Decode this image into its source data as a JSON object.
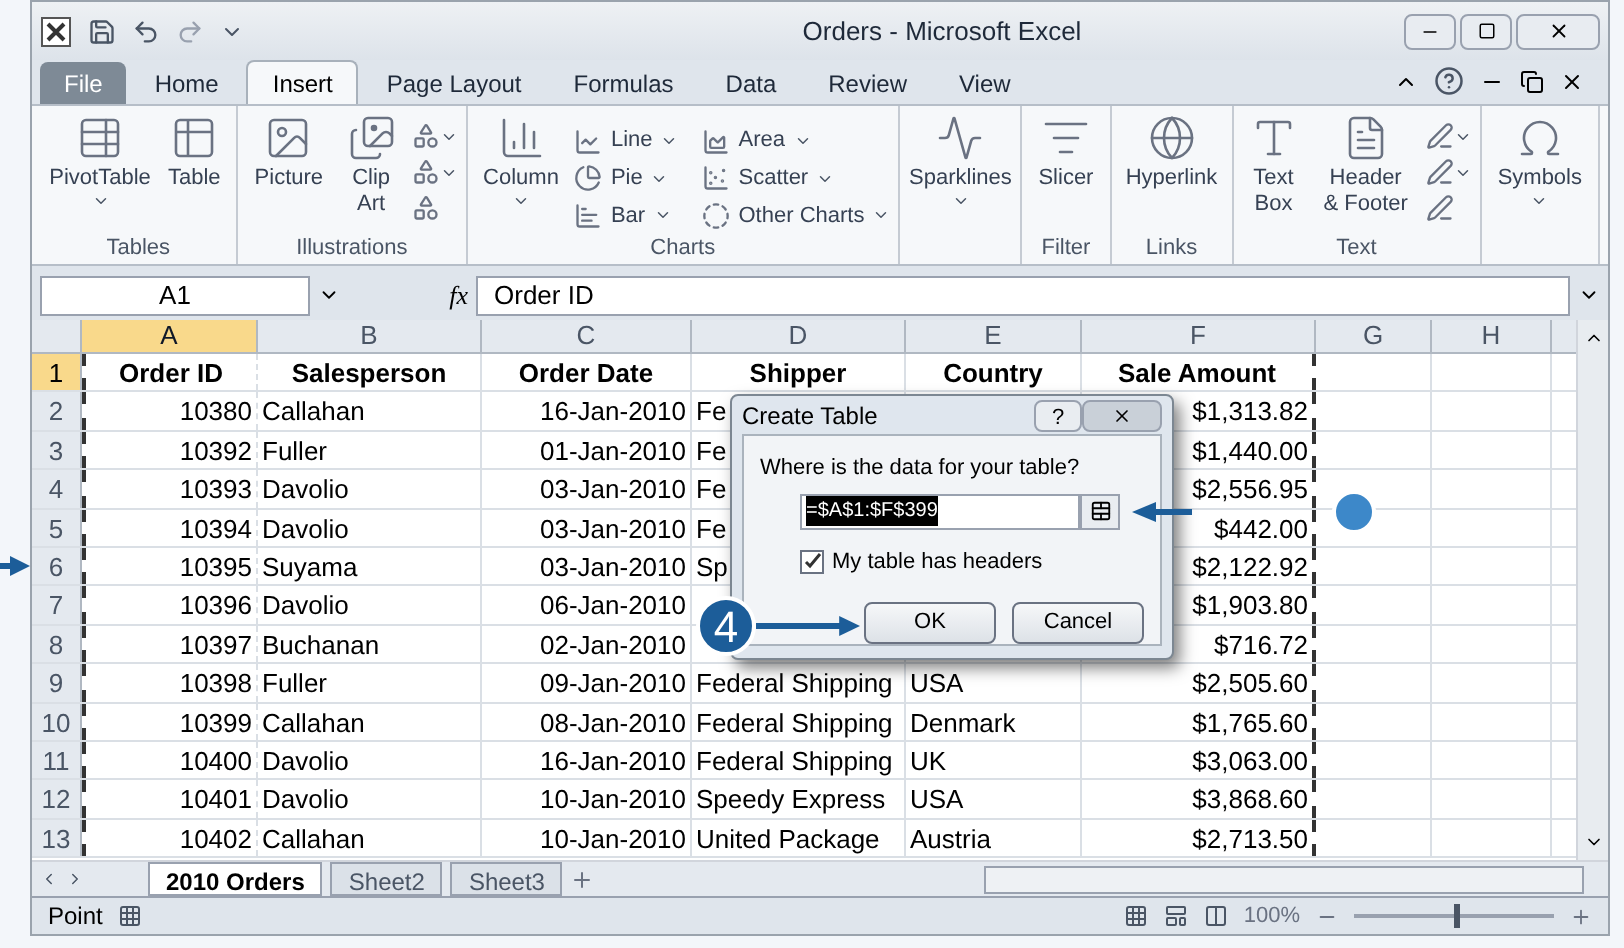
{
  "window": {
    "title": "Orders - Microsoft Excel"
  },
  "ribbon_tabs": [
    {
      "label": "File",
      "kind": "file",
      "selected": false
    },
    {
      "label": "Home",
      "kind": "tab",
      "selected": false
    },
    {
      "label": "Insert",
      "kind": "tab",
      "selected": true
    },
    {
      "label": "Page Layout",
      "kind": "tab",
      "selected": false
    },
    {
      "label": "Formulas",
      "kind": "tab",
      "selected": false
    },
    {
      "label": "Data",
      "kind": "tab",
      "selected": false
    },
    {
      "label": "Review",
      "kind": "tab",
      "selected": false
    },
    {
      "label": "View",
      "kind": "tab",
      "selected": false
    }
  ],
  "ribbon_groups": [
    {
      "label": "Tables",
      "buttons": [
        {
          "label": "PivotTable",
          "kind": "large",
          "dropdown": true
        },
        {
          "label": "Table",
          "kind": "large",
          "dropdown": false
        }
      ]
    },
    {
      "label": "Illustrations",
      "buttons": [
        {
          "label": "Picture",
          "kind": "large",
          "dropdown": false
        },
        {
          "label": "Clip Art",
          "kind": "large",
          "dropdown": false
        },
        {
          "kind": "stack",
          "dropdown": true
        }
      ]
    },
    {
      "label": "Charts",
      "buttons": [
        {
          "label": "Column",
          "kind": "large",
          "dropdown": true
        },
        {
          "label": "Line",
          "kind": "small",
          "dropdown": true
        },
        {
          "label": "Pie",
          "kind": "small",
          "dropdown": true
        },
        {
          "label": "Bar",
          "kind": "small",
          "dropdown": true
        },
        {
          "label": "Area",
          "kind": "small",
          "dropdown": true
        },
        {
          "label": "Scatter",
          "kind": "small",
          "dropdown": true
        },
        {
          "label": "Other Charts",
          "kind": "small",
          "dropdown": true
        }
      ]
    },
    {
      "buttons": [
        {
          "label": "Sparklines",
          "kind": "large",
          "dropdown": true
        }
      ]
    },
    {
      "label": "Filter",
      "buttons": [
        {
          "label": "Slicer",
          "kind": "large",
          "dropdown": false
        }
      ]
    },
    {
      "label": "Links",
      "buttons": [
        {
          "label": "Hyperlink",
          "kind": "large",
          "dropdown": false
        }
      ]
    },
    {
      "label": "Text",
      "buttons": [
        {
          "label": "Text Box",
          "kind": "large",
          "dropdown": false
        },
        {
          "label": "Header & Footer",
          "kind": "large",
          "dropdown": false
        },
        {
          "kind": "stack",
          "dropdown": true
        }
      ]
    },
    {
      "buttons": [
        {
          "label": "Symbols",
          "kind": "large",
          "dropdown": true
        }
      ]
    }
  ],
  "formula_bar": {
    "name_box": "A1",
    "function_label": "fx",
    "value": "Order ID"
  },
  "columns": [
    {
      "label": "A",
      "selected": true
    },
    {
      "label": "B",
      "selected": false
    },
    {
      "label": "C",
      "selected": false
    },
    {
      "label": "D",
      "selected": false
    },
    {
      "label": "E",
      "selected": false
    },
    {
      "label": "F",
      "selected": false
    },
    {
      "label": "G",
      "selected": false
    },
    {
      "label": "H",
      "selected": false
    }
  ],
  "table": {
    "header": [
      "Order ID",
      "Salesperson",
      "Order Date",
      "Shipper",
      "Country",
      "Sale Amount"
    ],
    "rows": [
      {
        "number": "1",
        "selected": true
      },
      {
        "number": "2",
        "selected": false,
        "cells": [
          "10380",
          "Callahan",
          "16-Jan-2010",
          "Fe",
          "",
          "$1,313.82"
        ]
      },
      {
        "number": "3",
        "selected": false,
        "cells": [
          "10392",
          "Fuller",
          "01-Jan-2010",
          "Fe",
          "",
          "$1,440.00"
        ]
      },
      {
        "number": "4",
        "selected": false,
        "cells": [
          "10393",
          "Davolio",
          "03-Jan-2010",
          "Fe",
          "",
          "$2,556.95"
        ]
      },
      {
        "number": "5",
        "selected": false,
        "cells": [
          "10394",
          "Davolio",
          "03-Jan-2010",
          "Fe",
          "",
          "$442.00"
        ]
      },
      {
        "number": "6",
        "selected": false,
        "cells": [
          "10395",
          "Suyama",
          "03-Jan-2010",
          "Sp",
          "",
          "$2,122.92"
        ]
      },
      {
        "number": "7",
        "selected": false,
        "cells": [
          "10396",
          "Davolio",
          "06-Jan-2010",
          "",
          "",
          "$1,903.80"
        ]
      },
      {
        "number": "8",
        "selected": false,
        "cells": [
          "10397",
          "Buchanan",
          "02-Jan-2010",
          "",
          "",
          "$716.72"
        ]
      },
      {
        "number": "9",
        "selected": false,
        "cells": [
          "10398",
          "Fuller",
          "09-Jan-2010",
          "Federal Shipping",
          "USA",
          "$2,505.60"
        ]
      },
      {
        "number": "10",
        "selected": false,
        "cells": [
          "10399",
          "Callahan",
          "08-Jan-2010",
          "Federal Shipping",
          "Denmark",
          "$1,765.60"
        ]
      },
      {
        "number": "11",
        "selected": false,
        "cells": [
          "10400",
          "Davolio",
          "16-Jan-2010",
          "Federal Shipping",
          "UK",
          "$3,063.00"
        ]
      },
      {
        "number": "12",
        "selected": false,
        "cells": [
          "10401",
          "Davolio",
          "10-Jan-2010",
          "Speedy Express",
          "USA",
          "$3,868.60"
        ]
      },
      {
        "number": "13",
        "selected": false,
        "cells": [
          "10402",
          "Callahan",
          "10-Jan-2010",
          "United Package",
          "Austria",
          "$2,713.50"
        ]
      }
    ]
  },
  "sheet_tabs": [
    {
      "label": "2010 Orders",
      "selected": true
    },
    {
      "label": "Sheet2",
      "selected": false
    },
    {
      "label": "Sheet3",
      "selected": false
    }
  ],
  "status_bar": {
    "mode": "Point",
    "zoom": "100%",
    "level": 0.5
  },
  "dialog": {
    "title": "Create Table",
    "help": "?",
    "question": "Where is the data for your table?",
    "range": "=$A$1:$F$399",
    "range_selected": true,
    "headers_label": "My table has headers",
    "headers_checked": true,
    "buttons": [
      "OK",
      "Cancel"
    ]
  },
  "callouts": [
    {
      "kind": "numbered",
      "label": "4"
    },
    {
      "kind": "dot"
    },
    {
      "kind": "arrow"
    }
  ]
}
